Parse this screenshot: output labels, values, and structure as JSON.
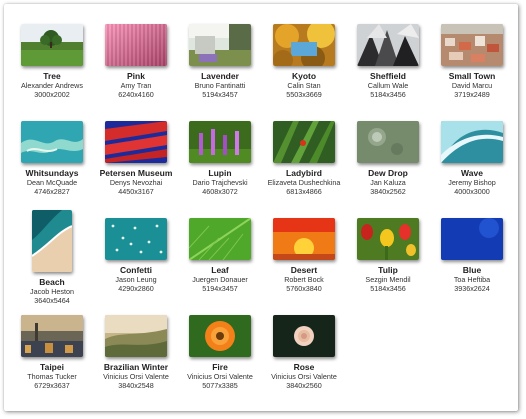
{
  "wallpapers": [
    {
      "title": "Tree",
      "author": "Alexander Andrews",
      "size": "3000x2002",
      "thumb": "tree",
      "orientation": "landscape"
    },
    {
      "title": "Pink",
      "author": "Amy Tran",
      "size": "6240x4160",
      "thumb": "pink",
      "orientation": "landscape"
    },
    {
      "title": "Lavender",
      "author": "Bruno Fantinatti",
      "size": "5194x3457",
      "thumb": "lavender",
      "orientation": "landscape"
    },
    {
      "title": "Kyoto",
      "author": "Calin Stan",
      "size": "5503x3669",
      "thumb": "kyoto",
      "orientation": "landscape"
    },
    {
      "title": "Sheffield",
      "author": "Callum Wale",
      "size": "5184x3456",
      "thumb": "sheffield",
      "orientation": "landscape"
    },
    {
      "title": "Small Town",
      "author": "David Marcu",
      "size": "3719x2489",
      "thumb": "smalltown",
      "orientation": "landscape"
    },
    {
      "title": "Whitsundays",
      "author": "Dean McQuade",
      "size": "4746x2827",
      "thumb": "whitsundays",
      "orientation": "landscape"
    },
    {
      "title": "Petersen Museum",
      "author": "Denys Nevozhai",
      "size": "4450x3167",
      "thumb": "petersen",
      "orientation": "landscape"
    },
    {
      "title": "Lupin",
      "author": "Dario Trajchevski",
      "size": "4608x3072",
      "thumb": "lupin",
      "orientation": "landscape"
    },
    {
      "title": "Ladybird",
      "author": "Elizaveta Dushechkina",
      "size": "6813x4866",
      "thumb": "ladybird",
      "orientation": "landscape"
    },
    {
      "title": "Dew Drop",
      "author": "Jan Kaluza",
      "size": "3840x2562",
      "thumb": "dewdrop",
      "orientation": "landscape"
    },
    {
      "title": "Wave",
      "author": "Jeremy Bishop",
      "size": "4000x3000",
      "thumb": "wave",
      "orientation": "landscape"
    },
    {
      "title": "Beach",
      "author": "Jacob Heston",
      "size": "3640x5464",
      "thumb": "beach",
      "orientation": "portrait"
    },
    {
      "title": "Confetti",
      "author": "Jason Leung",
      "size": "4290x2860",
      "thumb": "confetti",
      "orientation": "landscape"
    },
    {
      "title": "Leaf",
      "author": "Juergen Donauer",
      "size": "5194x3457",
      "thumb": "leaf",
      "orientation": "landscape"
    },
    {
      "title": "Desert",
      "author": "Robert Bock",
      "size": "5760x3840",
      "thumb": "desert",
      "orientation": "landscape"
    },
    {
      "title": "Tulip",
      "author": "Sezgin Mendil",
      "size": "5184x3456",
      "thumb": "tulip",
      "orientation": "landscape"
    },
    {
      "title": "Blue",
      "author": "Toa Heftiba",
      "size": "3936x2624",
      "thumb": "blue",
      "orientation": "landscape"
    },
    {
      "title": "Taipei",
      "author": "Thomas Tucker",
      "size": "6729x3637",
      "thumb": "taipei",
      "orientation": "landscape"
    },
    {
      "title": "Brazilian Winter",
      "author": "Vinicius Orsi Valente",
      "size": "3840x2548",
      "thumb": "brazilian",
      "orientation": "landscape"
    },
    {
      "title": "Fire",
      "author": "Vinicius Orsi Valente",
      "size": "5077x3385",
      "thumb": "fire",
      "orientation": "landscape"
    },
    {
      "title": "Rose",
      "author": "Vinicius Orsi Valente",
      "size": "3840x2560",
      "thumb": "rose",
      "orientation": "landscape"
    }
  ]
}
